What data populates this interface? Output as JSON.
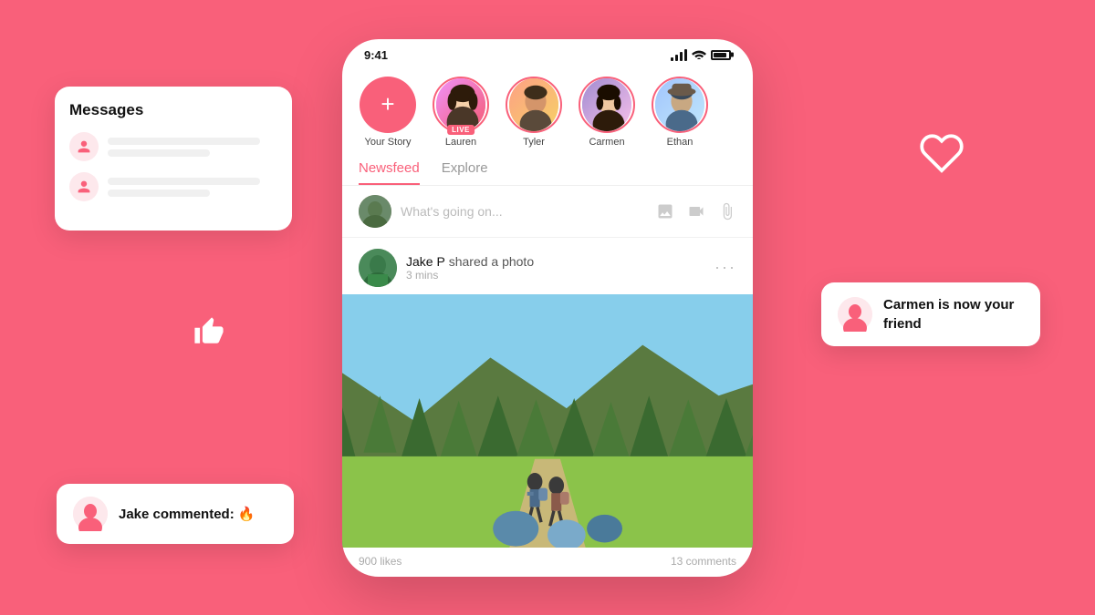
{
  "app": {
    "background_color": "#F9607A",
    "accent_color": "#F9607A"
  },
  "phone": {
    "status_bar": {
      "time": "9:41"
    },
    "stories": [
      {
        "id": "your-story",
        "label": "Your Story",
        "type": "add"
      },
      {
        "id": "lauren",
        "label": "Lauren",
        "live": true,
        "type": "story"
      },
      {
        "id": "tyler",
        "label": "Tyler",
        "live": false,
        "type": "story"
      },
      {
        "id": "carmen",
        "label": "Carmen",
        "live": false,
        "type": "story"
      },
      {
        "id": "ethan",
        "label": "Ethan",
        "live": false,
        "type": "story"
      }
    ],
    "tabs": [
      {
        "id": "newsfeed",
        "label": "Newsfeed",
        "active": true
      },
      {
        "id": "explore",
        "label": "Explore",
        "active": false
      }
    ],
    "post_input": {
      "placeholder": "What's going on..."
    },
    "post": {
      "username": "Jake P",
      "action": "shared a photo",
      "time": "3 mins",
      "likes": "900 likes",
      "comments": "13 comments"
    }
  },
  "messages_panel": {
    "title": "Messages"
  },
  "notifications": {
    "jake": "Jake commented: 🔥",
    "carmen": "Carmen is now your friend"
  }
}
